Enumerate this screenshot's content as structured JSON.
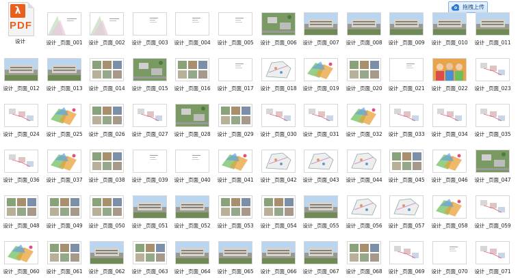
{
  "toolbar": {
    "upload_label": "拖拽上传"
  },
  "pdf_file": {
    "name": "设计",
    "badge": "PDF"
  },
  "page_prefix": "设计 _页面_",
  "files": [
    {
      "num": "001",
      "kind": "doc"
    },
    {
      "num": "002",
      "kind": "doc"
    },
    {
      "num": "003",
      "kind": "text"
    },
    {
      "num": "004",
      "kind": "text"
    },
    {
      "num": "005",
      "kind": "text"
    },
    {
      "num": "006",
      "kind": "aerial"
    },
    {
      "num": "007",
      "kind": "building"
    },
    {
      "num": "008",
      "kind": "building"
    },
    {
      "num": "009",
      "kind": "building"
    },
    {
      "num": "010",
      "kind": "building"
    },
    {
      "num": "011",
      "kind": "building"
    },
    {
      "num": "012",
      "kind": "building"
    },
    {
      "num": "013",
      "kind": "building"
    },
    {
      "num": "014",
      "kind": "photos"
    },
    {
      "num": "015",
      "kind": "aerial"
    },
    {
      "num": "016",
      "kind": "photos"
    },
    {
      "num": "017",
      "kind": "text"
    },
    {
      "num": "018",
      "kind": "map"
    },
    {
      "num": "019",
      "kind": "colormap"
    },
    {
      "num": "020",
      "kind": "photos"
    },
    {
      "num": "021",
      "kind": "text"
    },
    {
      "num": "022",
      "kind": "people"
    },
    {
      "num": "023",
      "kind": "diagram"
    },
    {
      "num": "024",
      "kind": "diagram"
    },
    {
      "num": "025",
      "kind": "colormap"
    },
    {
      "num": "026",
      "kind": "photos"
    },
    {
      "num": "027",
      "kind": "diagram"
    },
    {
      "num": "028",
      "kind": "aerial"
    },
    {
      "num": "029",
      "kind": "photos"
    },
    {
      "num": "030",
      "kind": "diagram"
    },
    {
      "num": "031",
      "kind": "diagram"
    },
    {
      "num": "032",
      "kind": "colormap"
    },
    {
      "num": "033",
      "kind": "diagram"
    },
    {
      "num": "034",
      "kind": "diagram"
    },
    {
      "num": "035",
      "kind": "diagram"
    },
    {
      "num": "036",
      "kind": "diagram"
    },
    {
      "num": "037",
      "kind": "colormap"
    },
    {
      "num": "038",
      "kind": "photos"
    },
    {
      "num": "039",
      "kind": "text"
    },
    {
      "num": "040",
      "kind": "text"
    },
    {
      "num": "041",
      "kind": "colormap"
    },
    {
      "num": "042",
      "kind": "map"
    },
    {
      "num": "043",
      "kind": "map"
    },
    {
      "num": "044",
      "kind": "map"
    },
    {
      "num": "045",
      "kind": "photos"
    },
    {
      "num": "046",
      "kind": "colormap"
    },
    {
      "num": "047",
      "kind": "aerial"
    },
    {
      "num": "048",
      "kind": "photos"
    },
    {
      "num": "049",
      "kind": "photos"
    },
    {
      "num": "050",
      "kind": "photos"
    },
    {
      "num": "051",
      "kind": "building"
    },
    {
      "num": "052",
      "kind": "building"
    },
    {
      "num": "053",
      "kind": "photos"
    },
    {
      "num": "054",
      "kind": "photos"
    },
    {
      "num": "055",
      "kind": "building"
    },
    {
      "num": "056",
      "kind": "map"
    },
    {
      "num": "057",
      "kind": "map"
    },
    {
      "num": "058",
      "kind": "colormap"
    },
    {
      "num": "059",
      "kind": "diagram"
    },
    {
      "num": "060",
      "kind": "colormap"
    },
    {
      "num": "061",
      "kind": "photos"
    },
    {
      "num": "062",
      "kind": "building"
    },
    {
      "num": "063",
      "kind": "photos"
    },
    {
      "num": "064",
      "kind": "building"
    },
    {
      "num": "065",
      "kind": "building"
    },
    {
      "num": "066",
      "kind": "building"
    },
    {
      "num": "067",
      "kind": "building"
    },
    {
      "num": "068",
      "kind": "photos"
    },
    {
      "num": "069",
      "kind": "diagram"
    },
    {
      "num": "070",
      "kind": "text"
    },
    {
      "num": "071",
      "kind": "diagram"
    }
  ],
  "colors": {
    "caption": "#222222",
    "accent": "#e95f1b",
    "upload_border": "#7fb0e0"
  }
}
